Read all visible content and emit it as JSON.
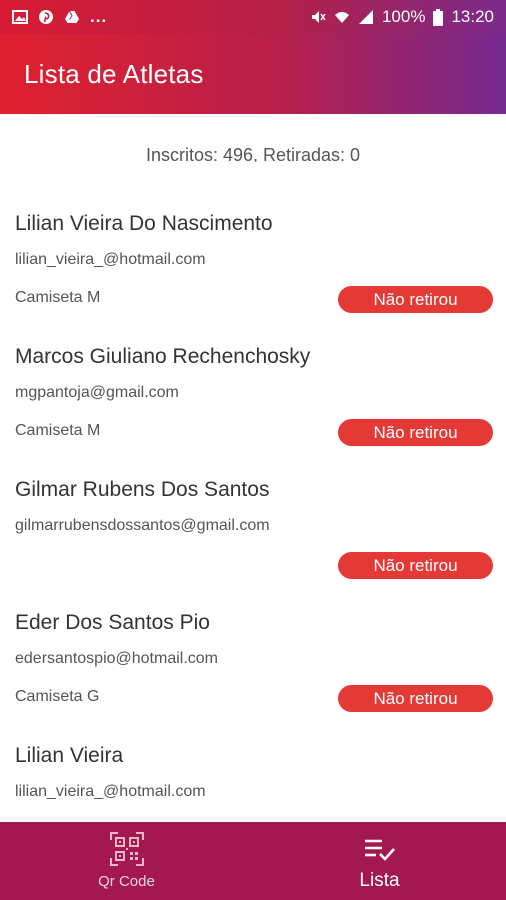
{
  "status_bar": {
    "left_icons": [
      "image-icon",
      "pinterest-icon",
      "drive-icon"
    ],
    "more": "...",
    "battery": "100%",
    "time": "13:20"
  },
  "app_bar": {
    "title": "Lista de Atletas"
  },
  "summary": "Inscritos: 496, Retiradas: 0",
  "athletes": [
    {
      "name": "Lilian Vieira Do Nascimento",
      "email": "lilian_vieira_@hotmail.com",
      "shirt": "Camiseta M",
      "status": "Não retirou"
    },
    {
      "name": "Marcos Giuliano Rechenchosky",
      "email": "mgpantoja@gmail.com",
      "shirt": "Camiseta M",
      "status": "Não retirou"
    },
    {
      "name": "Gilmar Rubens Dos Santos",
      "email": "gilmarrubensdossantos@gmail.com",
      "shirt": "",
      "status": "Não retirou"
    },
    {
      "name": "Eder Dos Santos Pio",
      "email": "edersantospio@hotmail.com",
      "shirt": "Camiseta G",
      "status": "Não retirou"
    },
    {
      "name": "Lilian Vieira",
      "email": "lilian_vieira_@hotmail.com",
      "shirt": "",
      "status": ""
    }
  ],
  "bottom_nav": {
    "items": [
      {
        "label": "Qr Code",
        "icon": "qr-code-icon"
      },
      {
        "label": "Lista",
        "icon": "list-check-icon"
      }
    ]
  },
  "colors": {
    "gradient_start": "#e0202f",
    "gradient_end": "#75298f",
    "badge": "#e53935",
    "bottom_nav": "#a3184f"
  }
}
